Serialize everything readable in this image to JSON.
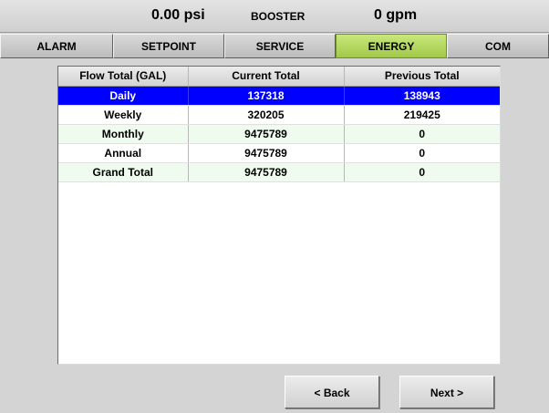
{
  "header": {
    "pressure": "0.00 psi",
    "mode": "BOOSTER",
    "flow": "0 gpm"
  },
  "tabs": [
    {
      "label": "ALARM",
      "active": false
    },
    {
      "label": "SETPOINT",
      "active": false
    },
    {
      "label": "SERVICE",
      "active": false
    },
    {
      "label": "ENERGY",
      "active": true
    },
    {
      "label": "COM",
      "active": false
    }
  ],
  "table": {
    "columns": [
      "Flow Total (GAL)",
      "Current Total",
      "Previous Total"
    ],
    "rows": [
      {
        "label": "Daily",
        "current": "137318",
        "previous": "138943",
        "selected": true
      },
      {
        "label": "Weekly",
        "current": "320205",
        "previous": "219425",
        "selected": false
      },
      {
        "label": "Monthly",
        "current": "9475789",
        "previous": "0",
        "selected": false
      },
      {
        "label": "Annual",
        "current": "9475789",
        "previous": "0",
        "selected": false
      },
      {
        "label": "Grand Total",
        "current": "9475789",
        "previous": "0",
        "selected": false
      }
    ]
  },
  "buttons": {
    "back_label": "< Back",
    "next_label": "Next >"
  },
  "colors": {
    "selected_row": "#0000ff",
    "active_tab": "#b4d65e",
    "alt_row": "#eefbee"
  }
}
